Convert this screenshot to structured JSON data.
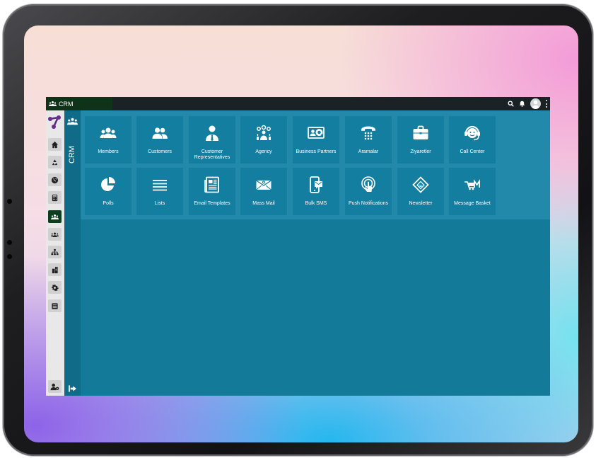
{
  "app": {
    "title": "CRM",
    "section_label": "CRM"
  },
  "colors": {
    "topbar": "#1b2226",
    "title_bg": "#0f3319",
    "content_bg": "#137a99",
    "panel_bg": "#2389ab",
    "tile_bg": "#137ea0",
    "rail_bg": "#e8e8e8",
    "rail_active": "#0c3d1d"
  },
  "topbar": {
    "icons": [
      "search-icon",
      "bell-icon",
      "user-avatar",
      "more-vertical-icon"
    ]
  },
  "rail": {
    "items": [
      {
        "name": "home-icon",
        "active": false
      },
      {
        "name": "recycle-icon",
        "active": false
      },
      {
        "name": "globe-icon",
        "active": false
      },
      {
        "name": "calculator-icon",
        "active": false
      },
      {
        "name": "users-icon",
        "active": true
      },
      {
        "name": "group-icon",
        "active": false
      },
      {
        "name": "sitemap-icon",
        "active": false
      },
      {
        "name": "buildings-icon",
        "active": false
      },
      {
        "name": "gear-icon",
        "active": false
      },
      {
        "name": "list-card-icon",
        "active": false
      }
    ],
    "bottom": "user-settings-icon"
  },
  "tiles": [
    {
      "label": "Members",
      "icon": "members-icon"
    },
    {
      "label": "Customers",
      "icon": "customers-icon"
    },
    {
      "label": "Customer Representatives",
      "icon": "representative-icon"
    },
    {
      "label": "Agency",
      "icon": "agency-icon"
    },
    {
      "label": "Business Partners",
      "icon": "business-partners-icon"
    },
    {
      "label": "Aramalar",
      "icon": "phone-icon"
    },
    {
      "label": "Ziyaretler",
      "icon": "briefcase-icon"
    },
    {
      "label": "Call Center",
      "icon": "headset-icon"
    },
    {
      "label": "Polls",
      "icon": "pie-chart-icon"
    },
    {
      "label": "Lists",
      "icon": "list-icon"
    },
    {
      "label": "Email Templates",
      "icon": "newspaper-icon"
    },
    {
      "label": "Mass Mail",
      "icon": "envelope-icon"
    },
    {
      "label": "Bulk SMS",
      "icon": "mobile-sms-icon"
    },
    {
      "label": "Push Notifications",
      "icon": "tap-icon"
    },
    {
      "label": "Newsletter",
      "icon": "newsletter-icon"
    },
    {
      "label": "Message Basket",
      "icon": "message-basket-icon"
    }
  ]
}
